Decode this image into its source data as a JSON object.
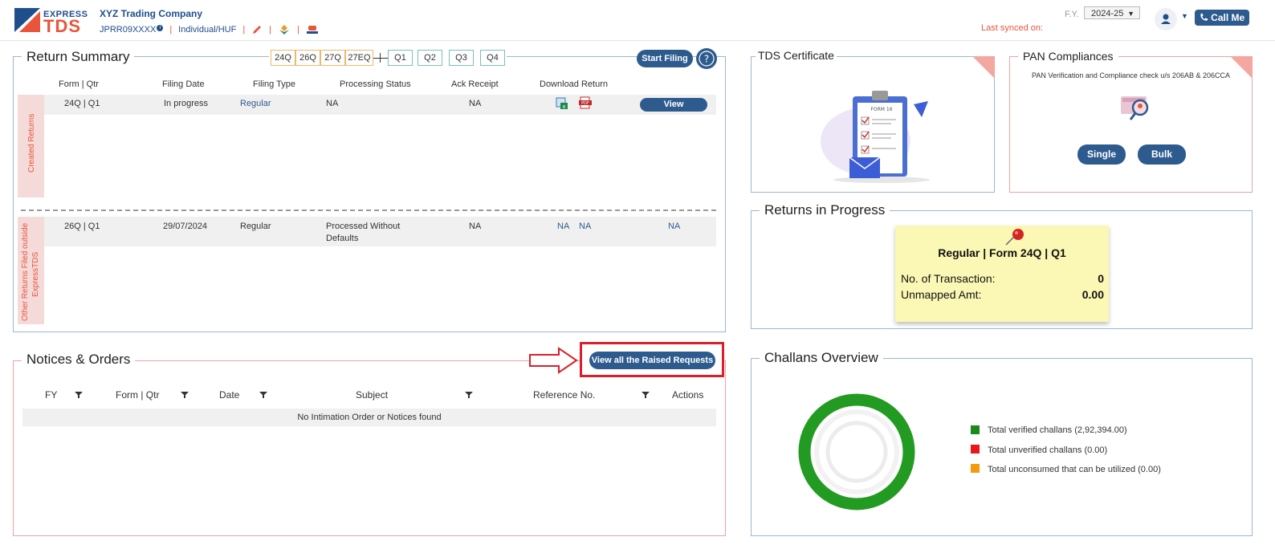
{
  "header": {
    "logo_top": "EXPRESS",
    "logo_bottom": "TDS",
    "company": "XYZ Trading Company",
    "pan": "JPRR09XXXX",
    "entity_type": "Individual/HUF",
    "fy_label": "F.Y.",
    "fy_value": "2024-25",
    "last_synced": "Last synced on:",
    "call_me": "Call Me"
  },
  "return_summary": {
    "title": "Return Summary",
    "forms": [
      "24Q",
      "26Q",
      "27Q",
      "27EQ"
    ],
    "quarters": [
      "Q1",
      "Q2",
      "Q3",
      "Q4"
    ],
    "start_filing": "Start Filing",
    "columns": [
      "Form | Qtr",
      "Filing Date",
      "Filing Type",
      "Processing Status",
      "Ack Receipt",
      "Download Return"
    ],
    "created_label": "Created Returns",
    "created_rows": [
      {
        "form_qtr": "24Q | Q1",
        "filing_date": "In progress",
        "filing_type": "Regular",
        "status": "NA",
        "ack": "NA",
        "action": "View"
      }
    ],
    "other_label_1": "Other Returns Filed outside",
    "other_label_2": "ExpressTDS",
    "other_rows": [
      {
        "form_qtr": "26Q | Q1",
        "filing_date": "29/07/2024",
        "filing_type": "Regular",
        "status_1": "Processed Without",
        "status_2": "Defaults",
        "ack": "NA",
        "dl1": "NA",
        "dl2": "NA",
        "action": "NA"
      }
    ]
  },
  "notices": {
    "title": "Notices & Orders",
    "view_all": "View all the Raised Requests",
    "columns": [
      "FY",
      "Form | Qtr",
      "Date",
      "Subject",
      "Reference No.",
      "Actions"
    ],
    "empty": "No Intimation Order or Notices found"
  },
  "tds_certificate": {
    "title": "TDS Certificate",
    "illustration_text": "FORM 16"
  },
  "pan_compliances": {
    "title": "PAN Compliances",
    "description": "PAN Verification and Compliance check u/s 206AB & 206CCA",
    "single": "Single",
    "bulk": "Bulk"
  },
  "returns_in_progress": {
    "title": "Returns in Progress",
    "card_title": "Regular | Form 24Q | Q1",
    "transactions_label": "No. of Transaction:",
    "transactions_value": "0",
    "unmapped_label": "Unmapped Amt:",
    "unmapped_value": "0.00"
  },
  "challans": {
    "title": "Challans Overview",
    "legend": [
      {
        "label": "Total verified challans (2,92,394.00)",
        "color": "#1a8a1a"
      },
      {
        "label": "Total unverified challans (0.00)",
        "color": "#e81818"
      },
      {
        "label": "Total unconsumed that can be utilized (0.00)",
        "color": "#f59a0e"
      }
    ]
  }
}
